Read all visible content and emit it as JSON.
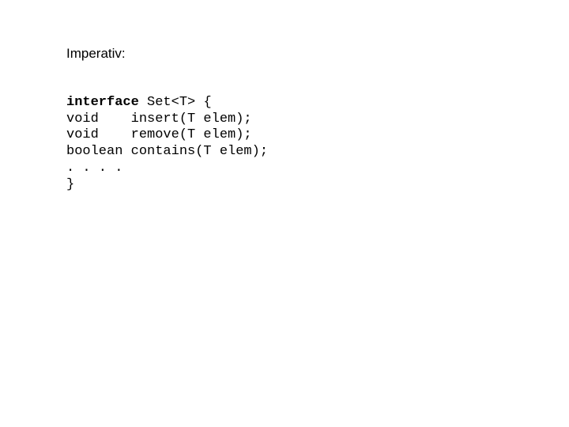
{
  "heading": "Imperativ:",
  "code": {
    "keyword": "interface",
    "line1_rest": " Set<T> {",
    "line2": "void    insert(T elem);",
    "line3": "void    remove(T elem);",
    "line4": "boolean contains(T elem);",
    "line5": ". . . .",
    "line6": "}"
  }
}
